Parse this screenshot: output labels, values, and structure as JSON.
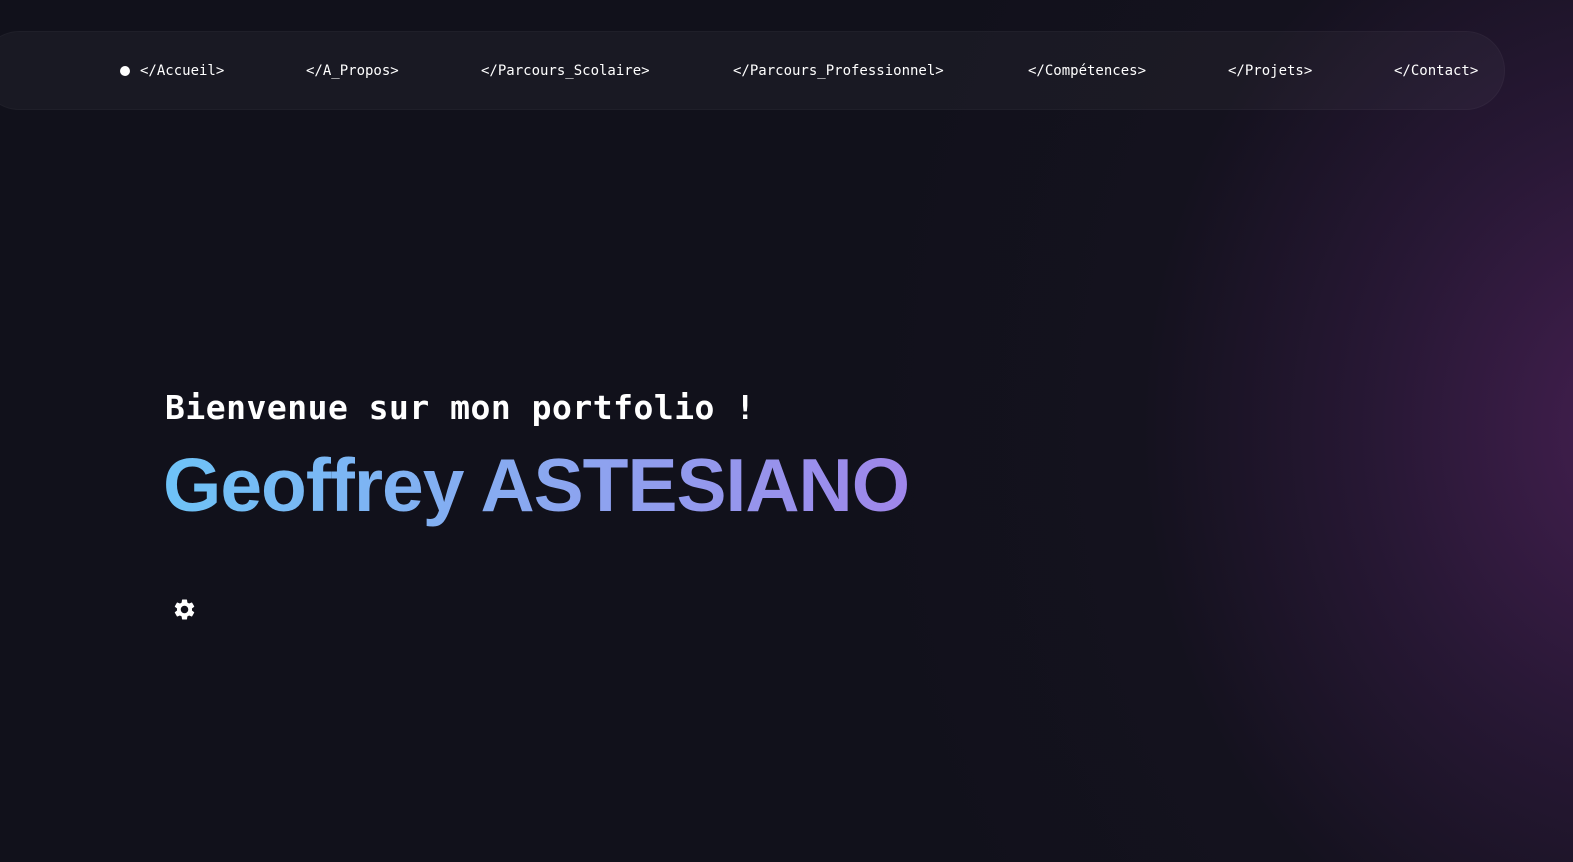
{
  "nav": {
    "items": [
      {
        "label": "</Accueil>",
        "active": true
      },
      {
        "label": "</A_Propos>"
      },
      {
        "label": "</Parcours_Scolaire>"
      },
      {
        "label": "</Parcours_Professionnel>"
      },
      {
        "label": "</Compétences>"
      },
      {
        "label": "</Projets>"
      },
      {
        "label": "</Contact>"
      }
    ]
  },
  "hero": {
    "welcome": "Bienvenue sur mon portfolio !",
    "name": "Geoffrey ASTESIANO",
    "settings_icon": "gear-icon"
  },
  "colors": {
    "background": "#11111b",
    "glow": "#3a2048",
    "gradient_start": "#6ec3f7",
    "gradient_end": "#9f86ea",
    "text": "#ffffff"
  }
}
